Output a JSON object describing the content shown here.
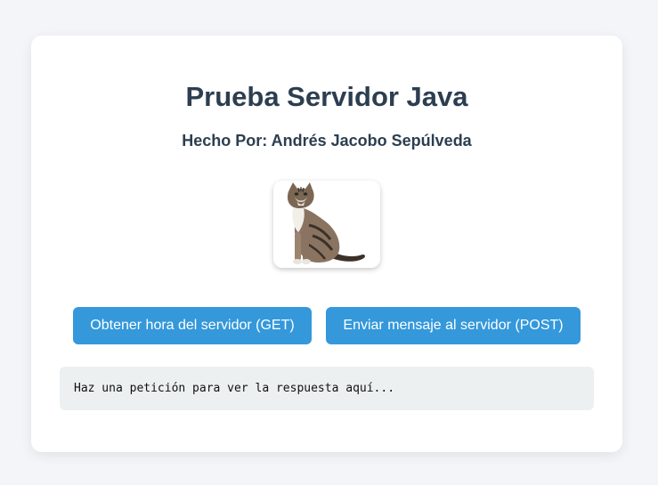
{
  "header": {
    "title": "Prueba Servidor Java",
    "subtitle": "Hecho Por: Andrés Jacobo Sepúlveda"
  },
  "image": {
    "icon": "cat-photo"
  },
  "actions": {
    "get_label": "Obtener hora del servidor (GET)",
    "post_label": "Enviar mensaje al servidor (POST)"
  },
  "response": {
    "text": "Haz una petición para ver la respuesta aquí..."
  },
  "colors": {
    "accent": "#3498db",
    "heading": "#2c3e50",
    "response_bg": "#ecf0f1",
    "page_bg": "#f3f5f8"
  }
}
